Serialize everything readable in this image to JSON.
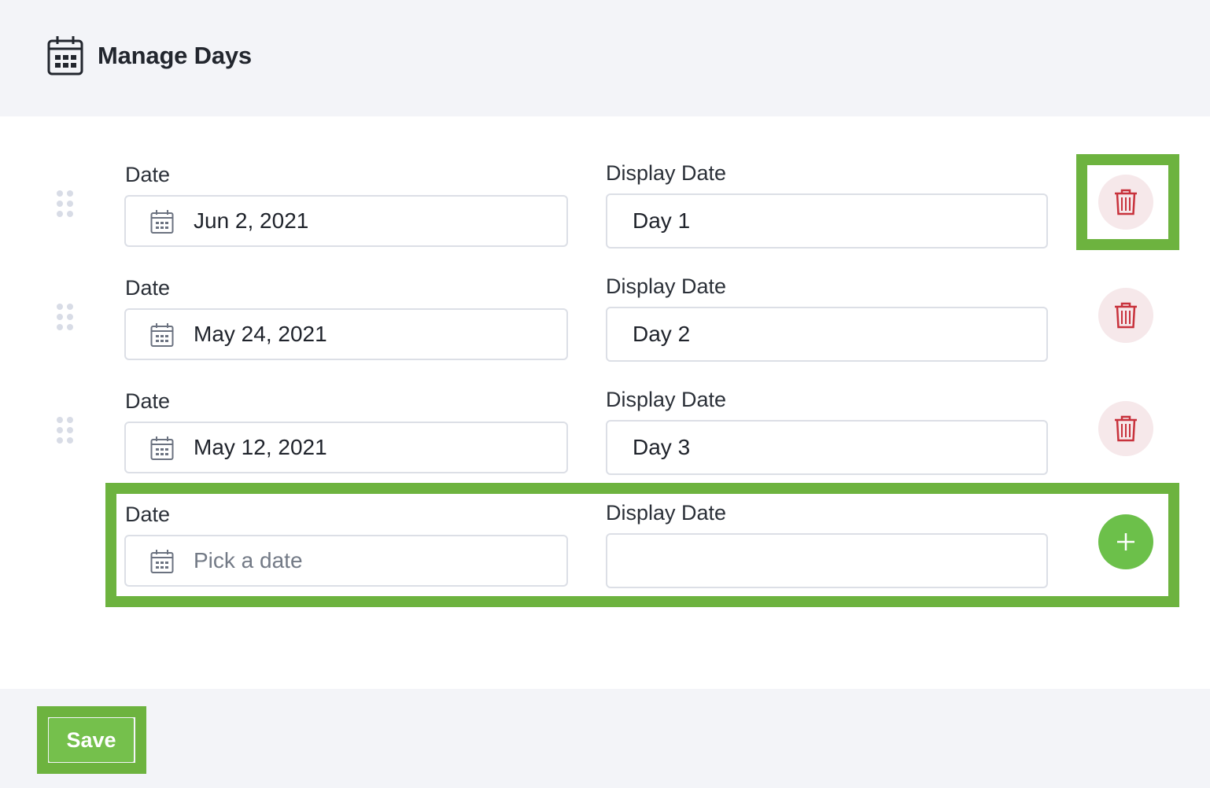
{
  "header": {
    "title": "Manage Days",
    "icon": "calendar-icon"
  },
  "rows": [
    {
      "date_label": "Date",
      "date_value": "Jun 2, 2021",
      "display_label": "Display Date",
      "display_value": "Day 1"
    },
    {
      "date_label": "Date",
      "date_value": "May 24, 2021",
      "display_label": "Display Date",
      "display_value": "Day 2"
    },
    {
      "date_label": "Date",
      "date_value": "May 12, 2021",
      "display_label": "Display Date",
      "display_value": "Day 3"
    }
  ],
  "new_row": {
    "date_label": "Date",
    "date_placeholder": "Pick a date",
    "display_label": "Display Date",
    "display_value": ""
  },
  "footer": {
    "save_label": "Save"
  },
  "colors": {
    "header_bg": "#f3f4f8",
    "delete_icon": "#c8323c",
    "delete_bg": "#f6e8ea",
    "add_button": "#6cc04a",
    "highlight": "#6db33f"
  }
}
